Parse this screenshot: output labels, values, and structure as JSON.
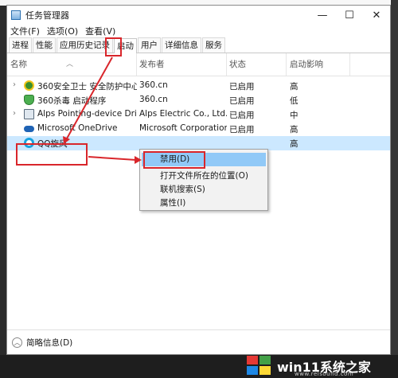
{
  "window": {
    "title": "任务管理器",
    "controls": {
      "minimize": "—",
      "maximize": "☐",
      "close": "✕"
    }
  },
  "menu": [
    "文件(F)",
    "选项(O)",
    "查看(V)"
  ],
  "tabs": [
    "进程",
    "性能",
    "应用历史记录",
    "启动",
    "用户",
    "详细信息",
    "服务"
  ],
  "active_tab": "启动",
  "columns": {
    "name": "名称",
    "publisher": "发布者",
    "status": "状态",
    "impact": "启动影响"
  },
  "rows": [
    {
      "expander": "›",
      "icon": "360-safe-guard-icon",
      "name": "360安全卫士 安全防护中心...",
      "publisher": "360.cn",
      "status": "已启用",
      "impact": "高"
    },
    {
      "expander": "",
      "icon": "360-antivirus-shield-icon",
      "name": "360杀毒 启动程序",
      "publisher": "360.cn",
      "status": "已启用",
      "impact": "低"
    },
    {
      "expander": "›",
      "icon": "alps-pointing-device-icon",
      "name": "Alps Pointing-device Driv...",
      "publisher": "Alps Electric Co., Ltd.",
      "status": "已启用",
      "impact": "中"
    },
    {
      "expander": "",
      "icon": "onedrive-cloud-icon",
      "name": "Microsoft OneDrive",
      "publisher": "Microsoft Corporation",
      "status": "已启用",
      "impact": "高"
    },
    {
      "expander": "",
      "icon": "qq-whirlwind-icon",
      "name": "QQ旋风",
      "publisher": "",
      "status": "",
      "impact": "高"
    }
  ],
  "context_menu": [
    "禁用(D)",
    "打开文件所在的位置(O)",
    "联机搜索(S)",
    "属性(I)"
  ],
  "footer": {
    "label": "简略信息(D)"
  },
  "watermark": {
    "brand": "win11系统之家",
    "url": "www.relsound.com"
  },
  "colors": {
    "annotation_red": "#d9262b",
    "selection_blue": "#cce8ff",
    "menu_hover": "#91c9f7"
  }
}
